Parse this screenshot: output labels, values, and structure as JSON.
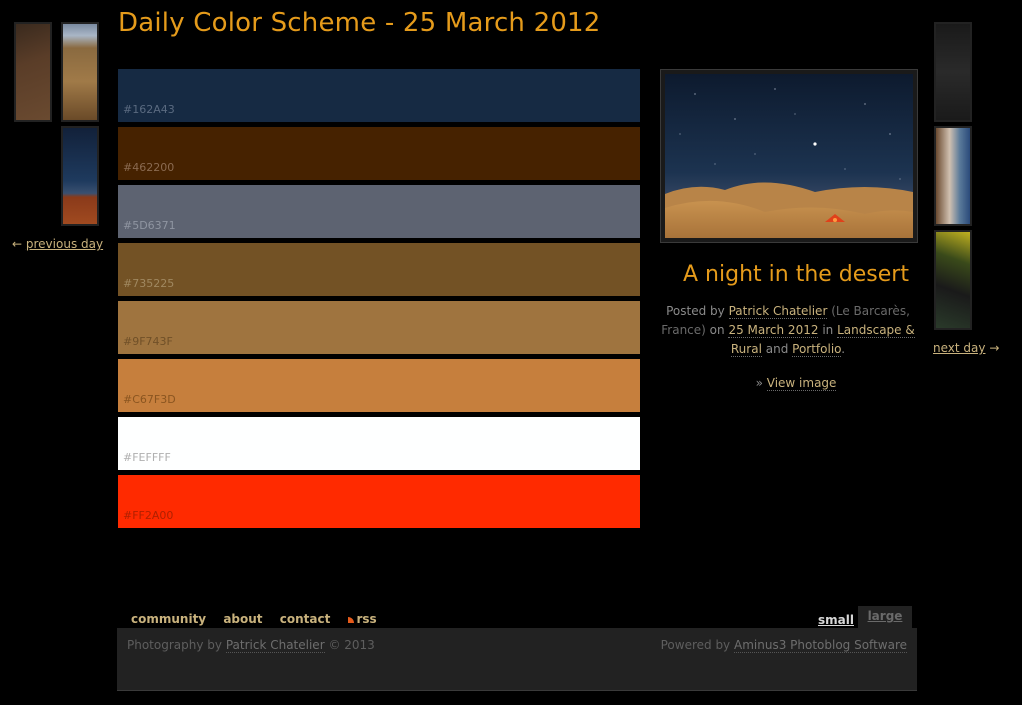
{
  "page_title": "Daily Color Scheme - 25 March 2012",
  "prev_nav": {
    "arrow": "←",
    "label": "previous day"
  },
  "next_nav": {
    "arrow": "→",
    "label": "next day"
  },
  "swatches": [
    {
      "code": "#162A43",
      "color": "#162A43",
      "text_color": "#5a6a80"
    },
    {
      "code": "#462200",
      "color": "#462200",
      "text_color": "#8a6a50"
    },
    {
      "code": "#5D6371",
      "color": "#5D6371",
      "text_color": "#8f95a1"
    },
    {
      "code": "#735225",
      "color": "#735225",
      "text_color": "#a08860"
    },
    {
      "code": "#9F743F",
      "color": "#9F743F",
      "text_color": "#705028"
    },
    {
      "code": "#C67F3D",
      "color": "#C67F3D",
      "text_color": "#8a5520"
    },
    {
      "code": "#FEFFFF",
      "color": "#FEFFFF",
      "text_color": "#b0b0b0"
    },
    {
      "code": "#FF2A00",
      "color": "#FF2A00",
      "text_color": "#b02000"
    }
  ],
  "post": {
    "title": "A night in the desert",
    "posted_by_prefix": "Posted by",
    "author": "Patrick Chatelier",
    "location": "(Le Barcarès, France)",
    "on_text": "on",
    "date": "25 March 2012",
    "in_text": "in",
    "category1": "Landscape & Rural",
    "and_text": "and",
    "category2": "Portfolio",
    "period": ".",
    "view_prefix": "»",
    "view_label": "View image"
  },
  "footer_nav": {
    "community": "community",
    "about": "about",
    "contact": "contact",
    "rss": "rss"
  },
  "size_switch": {
    "small": "small",
    "large": "large"
  },
  "footer": {
    "left_prefix": "Photography by",
    "left_author": "Patrick Chatelier",
    "left_suffix": "© 2013",
    "right_prefix": "Powered by",
    "right_link": "Aminus3 Photoblog Software"
  },
  "colors": {
    "accent": "#e59b1b",
    "link": "#c9b27d",
    "background": "#000000"
  }
}
